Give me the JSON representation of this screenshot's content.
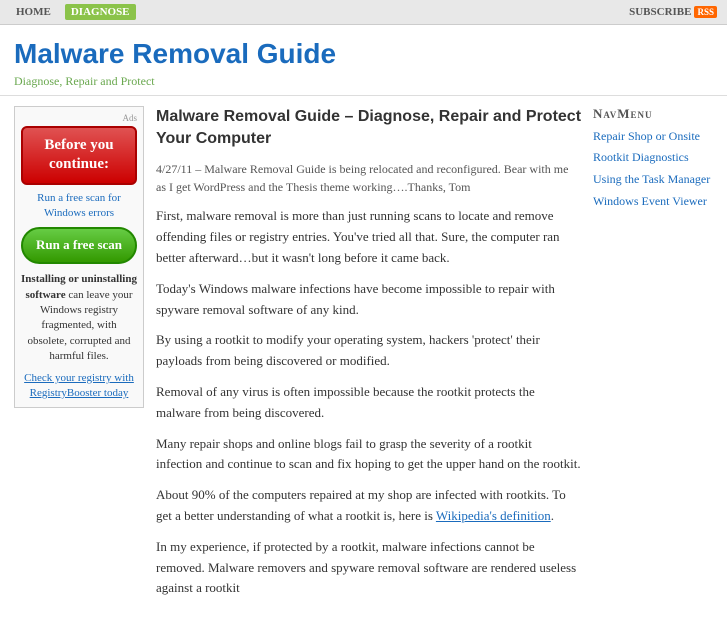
{
  "topnav": {
    "home_label": "HOME",
    "diagnose_label": "DIAGNOSE",
    "subscribe_label": "SUBSCRIBE"
  },
  "header": {
    "title": "Malware Removal Guide",
    "subtitle": "Diagnose, Repair and Protect"
  },
  "sidebar_left": {
    "ad_label": "Ads",
    "before_continue": "Before you continue:",
    "run_free_text": "Run a free scan for Windows errors",
    "run_scan_btn": "Run a free scan",
    "description": "Installing or uninstalling software can leave your Windows registry fragmented, with obsolete, corrupted and harmful files.",
    "check_link": "Check your registry with RegistryBooster today"
  },
  "article": {
    "title": "Malware Removal Guide – Diagnose, Repair and Protect Your Computer",
    "date_text": "4/27/11 – Malware Removal Guide is being relocated and reconfigured. Bear with me as I get WordPress and the Thesis theme working….Thanks, Tom",
    "paragraphs": [
      "First, malware removal is more than just running scans to locate and remove offending files or registry entries. You've tried all that. Sure, the computer ran better afterward…but it wasn't long before it came back.",
      "Today's Windows malware infections have become impossible to repair with spyware removal software of any kind.",
      "By using a rootkit to modify your operating system, hackers 'protect' their payloads from being discovered or modified.",
      "Removal of any virus is often impossible because the rootkit protects the malware from being discovered.",
      "Many repair shops and online blogs fail to grasp the severity of a rootkit infection and continue to scan and fix hoping to get the upper hand on the rootkit.",
      "About 90% of the computers repaired at my shop are infected with rootkits. To get a better understanding of what a rootkit is, here is Wikipedia's definition.",
      "In my experience, if protected by a rootkit, malware infections cannot be removed. Malware removers and spyware removal software are rendered useless against a rootkit"
    ],
    "wikipedia_link": "Wikipedia's definition"
  },
  "right_sidebar": {
    "nav_title": "NavMenu",
    "items": [
      "Repair Shop or Onsite",
      "Rootkit Diagnostics",
      "Using the Task Manager",
      "Windows Event Viewer"
    ]
  }
}
